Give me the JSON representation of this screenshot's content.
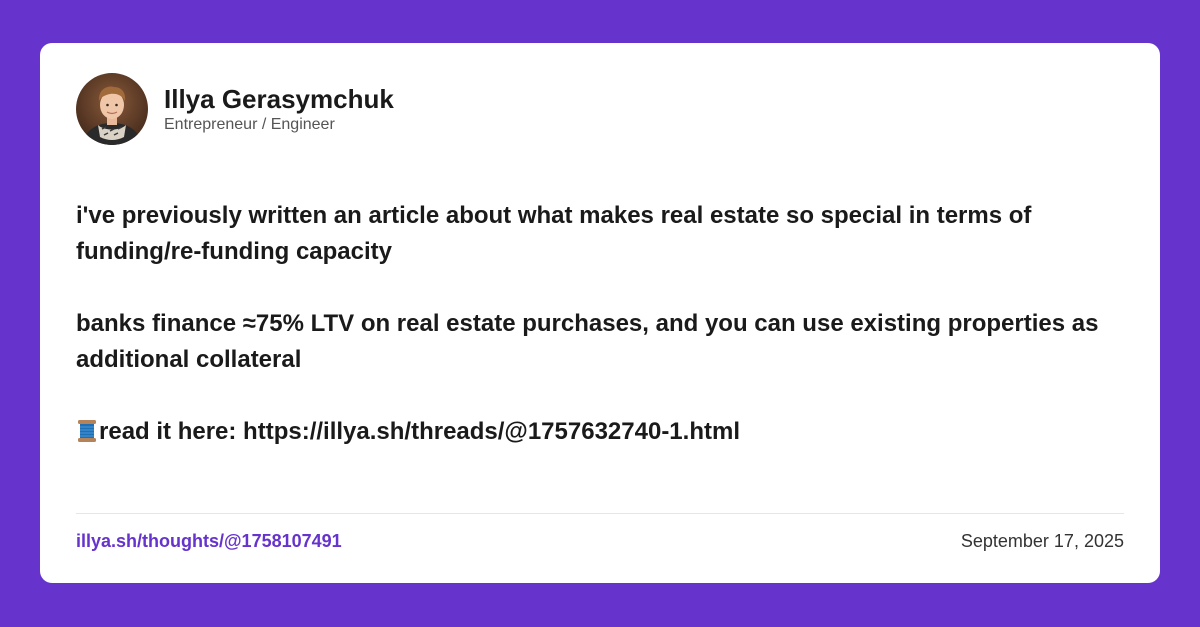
{
  "colors": {
    "background": "#6633cc",
    "card": "#ffffff",
    "link": "#6633cc",
    "text": "#1a1a1a",
    "muted": "#555555"
  },
  "author": {
    "name": "Illya Gerasymchuk",
    "title": "Entrepreneur / Engineer",
    "avatar_icon": "avatar-photo"
  },
  "post": {
    "paragraph_1": "i've previously written an article about what makes real estate so special in terms of funding/re-funding capacity",
    "paragraph_2": "banks finance ≈75% LTV on real estate purchases, and you can use existing properties as additional collateral",
    "paragraph_3_icon": "spool-of-thread-icon",
    "paragraph_3": "read it here: https://illya.sh/threads/@1757632740-1.html"
  },
  "footer": {
    "link": "illya.sh/thoughts/@1758107491",
    "date": "September 17, 2025"
  }
}
